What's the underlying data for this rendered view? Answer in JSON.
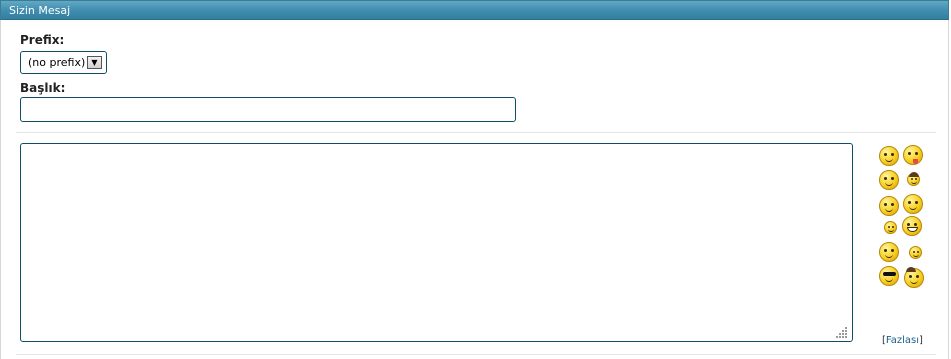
{
  "panel": {
    "title": "Sizin Mesaj"
  },
  "form": {
    "prefix_label": "Prefix:",
    "prefix_value": "(no prefix)",
    "title_label": "Başlık:",
    "title_value": ""
  },
  "editor": {
    "content": ""
  },
  "smilies": [
    "tired-smiley-icon",
    "tongue-smiley-icon",
    "wink-smiley-icon",
    "capped-smiley-icon",
    "clapping-smiley-icon",
    "grin-smiley-icon",
    "egg-smiley-icon",
    "laughing-smiley-icon",
    "blush-smiley-icon",
    "tiny-smiley-icon",
    "cool-smiley-icon",
    "hat-smiley-icon"
  ],
  "more_smilies": {
    "open": "[",
    "label": "Fazlası",
    "close": "]"
  },
  "colors": {
    "header": "#3f8caf",
    "border": "#0f4f66",
    "link": "#1a5f8a"
  }
}
